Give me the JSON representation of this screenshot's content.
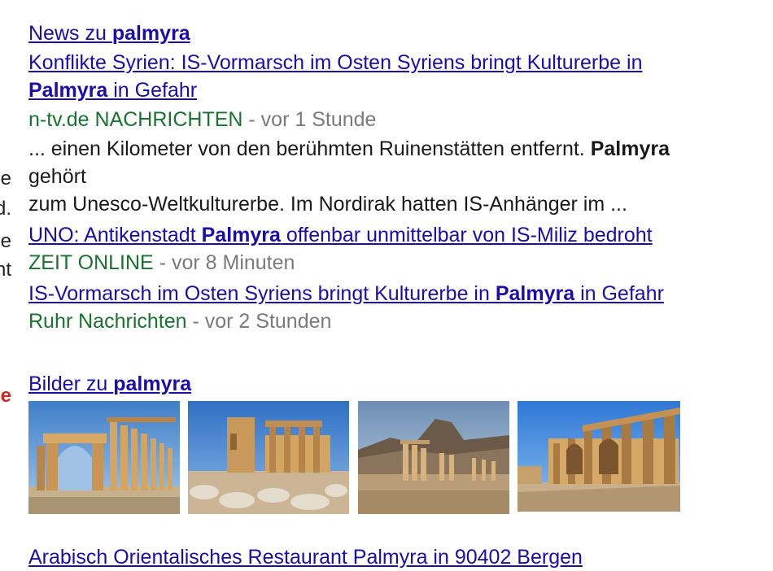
{
  "left_fragments": [
    "e",
    "d.",
    "e",
    "nt",
    "e"
  ],
  "news": {
    "header_prefix": "News zu ",
    "header_query": "palmyra",
    "articles": [
      {
        "title_part1": "Konflikte Syrien: IS-Vormarsch im Osten Syriens bringt Kulturerbe in",
        "title_bold": "Palmyra",
        "title_part2": " in Gefahr",
        "source": "n-tv.de NACHRICHTEN",
        "time": " - vor 1 Stunde",
        "snippet_line1_a": "... einen Kilometer von den berühmten Ruinenstätten entfernt. ",
        "snippet_line1_bold": "Palmyra",
        "snippet_line2": "gehört",
        "snippet_line3": "zum Unesco-Weltkulturerbe. Im Nordirak hatten IS-Anhänger im ..."
      },
      {
        "title_part1": "UNO: Antikenstadt ",
        "title_bold": "Palmyra",
        "title_part2": " offenbar unmittelbar von IS-Miliz bedroht",
        "source": "ZEIT ONLINE",
        "time": " - vor 8 Minuten"
      },
      {
        "title_part1": "IS-Vormarsch im Osten Syriens bringt Kulturerbe in ",
        "title_bold": "Palmyra",
        "title_part2": " in Gefahr",
        "source": "Ruhr Nachrichten",
        "time": " - vor 2 Stunden"
      }
    ]
  },
  "images": {
    "header_prefix": "Bilder zu ",
    "header_query": "palmyra",
    "thumbnails": [
      {
        "name": "arch-colonnade-thumbnail"
      },
      {
        "name": "temple-ruins-thumbnail"
      },
      {
        "name": "colonnade-mountain-thumbnail"
      },
      {
        "name": "theater-ruins-thumbnail"
      }
    ]
  },
  "bottom_cut_text": "Arabisch Orientalisches Restaurant Palmyra in 90402 Bergen"
}
